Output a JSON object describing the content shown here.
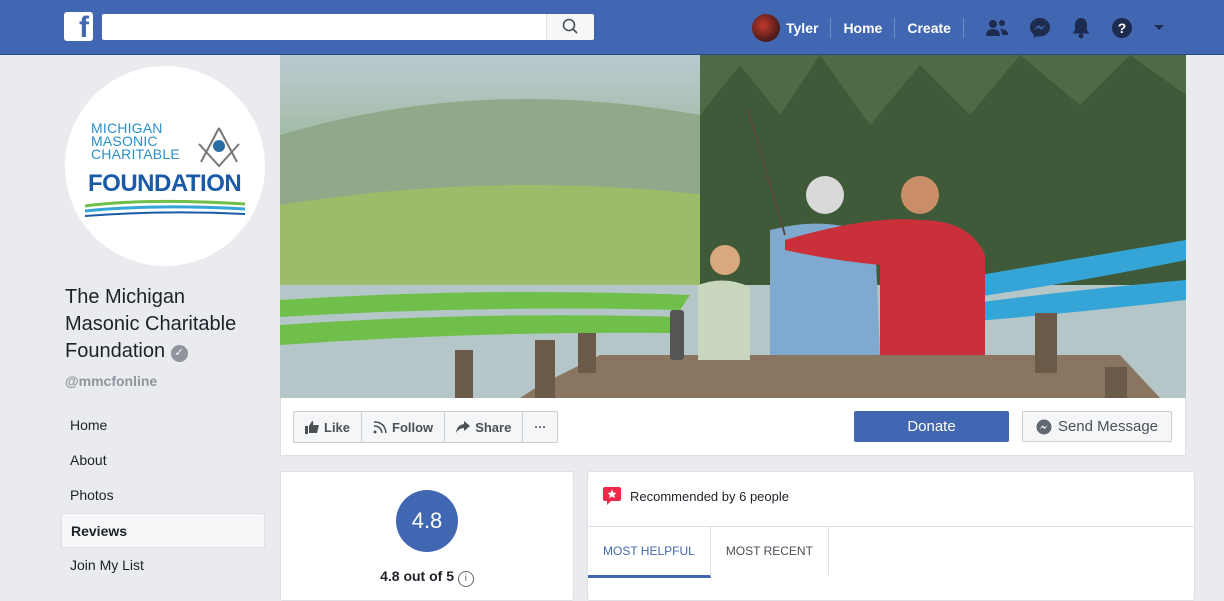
{
  "header": {
    "search_placeholder": "",
    "user_name": "Tyler",
    "nav_home": "Home",
    "nav_create": "Create",
    "icons": [
      "friends-icon",
      "messenger-icon",
      "bell-icon",
      "help-icon",
      "caret-down-icon"
    ]
  },
  "page": {
    "logo_lines": [
      "MICHIGAN",
      "MASONIC",
      "CHARITABLE",
      "FOUNDATION"
    ],
    "title_lines": [
      "The Michigan",
      "Masonic Charitable",
      "Foundation"
    ],
    "handle": "@mmcfonline"
  },
  "sidebar": {
    "items": [
      {
        "label": "Home"
      },
      {
        "label": "About"
      },
      {
        "label": "Photos"
      },
      {
        "label": "Reviews",
        "active": true
      },
      {
        "label": "Join My List"
      }
    ]
  },
  "actions": {
    "like": "Like",
    "follow": "Follow",
    "share": "Share",
    "more": "···",
    "donate": "Donate",
    "send_message": "Send Message"
  },
  "rating": {
    "score": "4.8",
    "summary": "4.8 out of 5",
    "info": "i"
  },
  "recommendations": {
    "header": "Recommended by 6 people",
    "tabs": [
      "MOST HELPFUL",
      "MOST RECENT"
    ]
  },
  "colors": {
    "brand": "#4267b2",
    "background": "#e9ebee"
  }
}
